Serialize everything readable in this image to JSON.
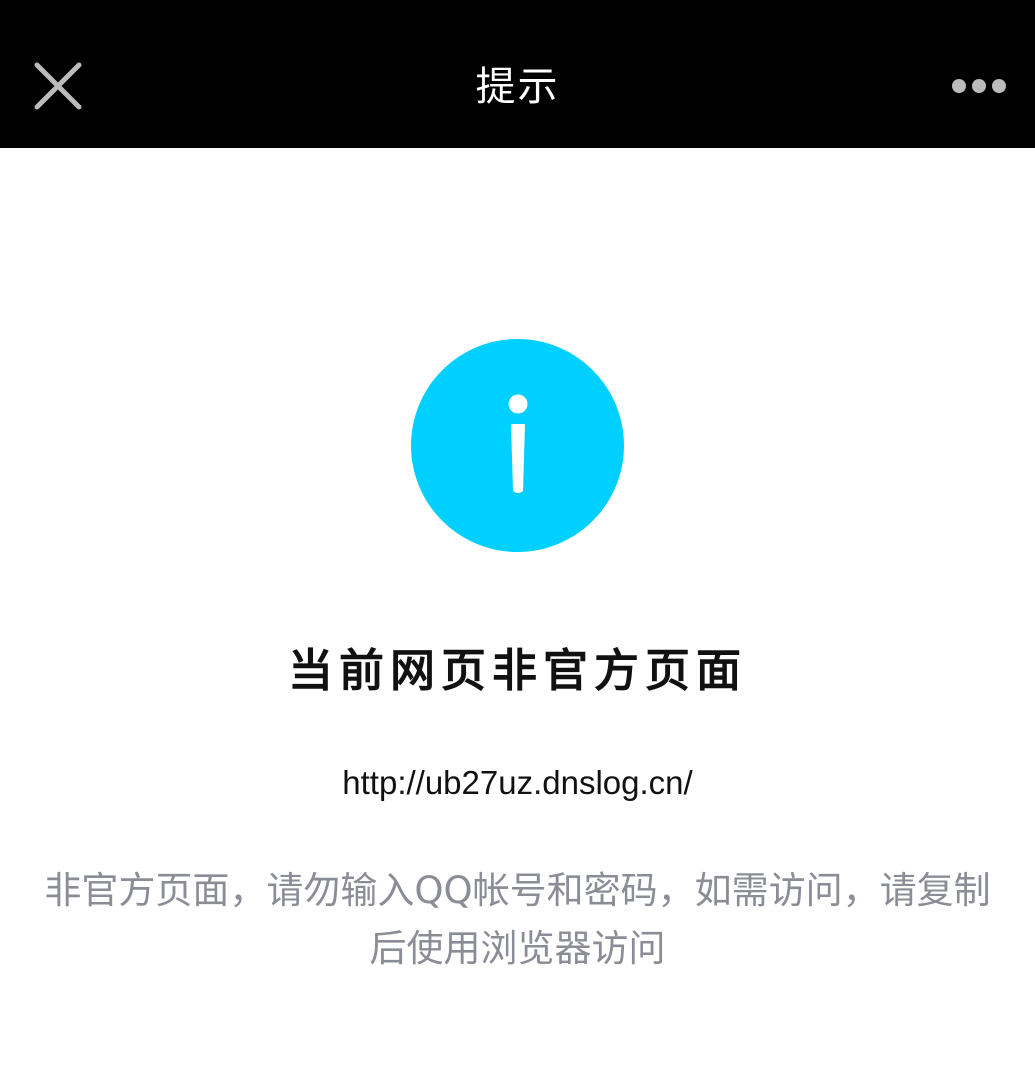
{
  "header": {
    "title": "提示",
    "close_icon": "close-icon",
    "more_icon": "more-horizontal-icon"
  },
  "content": {
    "icon": "info-icon",
    "icon_color": "#00d0ff",
    "headline": "当前网页非官方页面",
    "url": "http://ub27uz.dnslog.cn/",
    "description": "非官方页面，请勿输入QQ帐号和密码，如需访问，请复制后使用浏览器访问"
  }
}
